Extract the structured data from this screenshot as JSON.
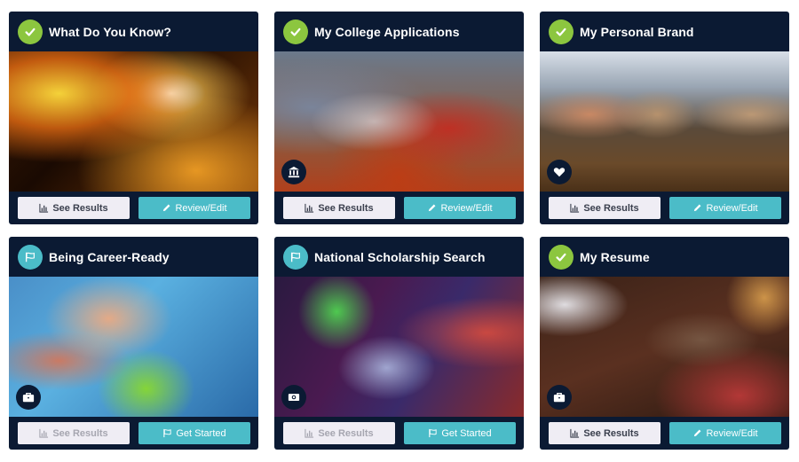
{
  "colors": {
    "card_bg": "#0b1a33",
    "complete_green": "#8cc63f",
    "pending_teal": "#4bbcc8",
    "button_light": "#efedf4",
    "button_teal": "#4bbcc8"
  },
  "cards": [
    {
      "title": "What Do You Know?",
      "status": "complete",
      "status_icon": "check-icon",
      "category_icon": null,
      "results_label": "See Results",
      "results_enabled": true,
      "action_label": "Review/Edit",
      "action_icon": "pencil-icon"
    },
    {
      "title": "My College Applications",
      "status": "complete",
      "status_icon": "check-icon",
      "category_icon": "institution-icon",
      "results_label": "See Results",
      "results_enabled": true,
      "action_label": "Review/Edit",
      "action_icon": "pencil-icon"
    },
    {
      "title": "My Personal Brand",
      "status": "complete",
      "status_icon": "check-icon",
      "category_icon": "heart-icon",
      "results_label": "See Results",
      "results_enabled": true,
      "action_label": "Review/Edit",
      "action_icon": "pencil-icon"
    },
    {
      "title": "Being Career-Ready",
      "status": "not-started",
      "status_icon": "flag-icon",
      "category_icon": "briefcase-icon",
      "results_label": "See Results",
      "results_enabled": false,
      "action_label": "Get Started",
      "action_icon": "flag-icon"
    },
    {
      "title": "National Scholarship Search",
      "status": "not-started",
      "status_icon": "flag-icon",
      "category_icon": "money-icon",
      "results_label": "See Results",
      "results_enabled": false,
      "action_label": "Get Started",
      "action_icon": "flag-icon"
    },
    {
      "title": "My Resume",
      "status": "complete",
      "status_icon": "check-icon",
      "category_icon": "briefcase-icon",
      "results_label": "See Results",
      "results_enabled": true,
      "action_label": "Review/Edit",
      "action_icon": "pencil-icon"
    }
  ]
}
